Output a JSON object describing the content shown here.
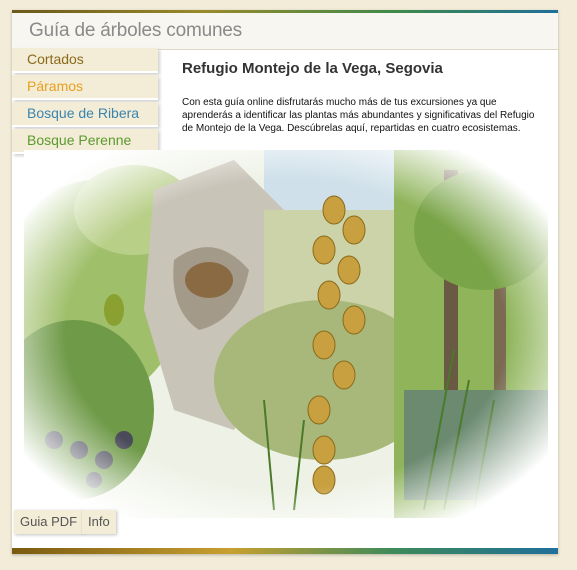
{
  "header": {
    "title": "Guía de árboles comunes"
  },
  "nav": {
    "items": [
      {
        "label": "Cortados",
        "color": "#8a6a1a"
      },
      {
        "label": "Páramos",
        "color": "#e8a020"
      },
      {
        "label": "Bosque de Ribera",
        "color": "#3a84b0"
      },
      {
        "label": "Bosque Perenne",
        "color": "#5a9a30"
      }
    ]
  },
  "content": {
    "title": "Refugio Montejo de la Vega, Segovia",
    "text": "Con esta guía online disfrutarás mucho más de tus excursiones ya que aprenderás a identificar las plantas más abundantes y significativas del Refugio de Montejo de la Vega. Descúbrelas aquí, repartidas en cuatro ecosistemas."
  },
  "footer": {
    "pdf_label": "Guia PDF",
    "info_label": "Info"
  }
}
